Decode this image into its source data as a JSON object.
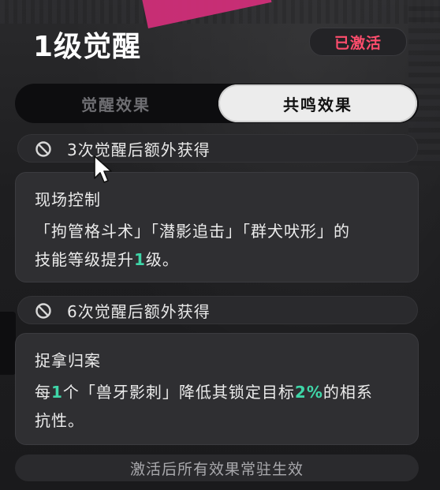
{
  "header": {
    "title": "1级觉醒",
    "status_badge": "已激活"
  },
  "tabs": [
    {
      "label": "觉醒效果",
      "active": false
    },
    {
      "label": "共鸣效果",
      "active": true
    }
  ],
  "sections": [
    {
      "icon": "ban-icon",
      "heading": "3次觉醒后额外获得",
      "card": {
        "title": "现场控制",
        "line1": "「拘管格斗术」「潜影追击」「群犬吠形」的",
        "line2_pre": "技能等级提升",
        "line2_highlight": "1",
        "line2_post": "级。"
      }
    },
    {
      "icon": "ban-icon",
      "heading": "6次觉醒后额外获得",
      "card": {
        "title": "捉拿归案",
        "line1_pre": "每",
        "line1_highlight_a": "1",
        "line1_mid": "个「兽牙影刺」降低其锁定目标",
        "line1_highlight_b": "2%",
        "line1_post": "的相系",
        "line2": "抗性。"
      }
    }
  ],
  "footer": {
    "note": "激活后所有效果常驻生效"
  },
  "colors": {
    "badge_text": "#ff4d6d",
    "highlight": "#3fd6a8",
    "active_tab_bg": "#ececec"
  }
}
